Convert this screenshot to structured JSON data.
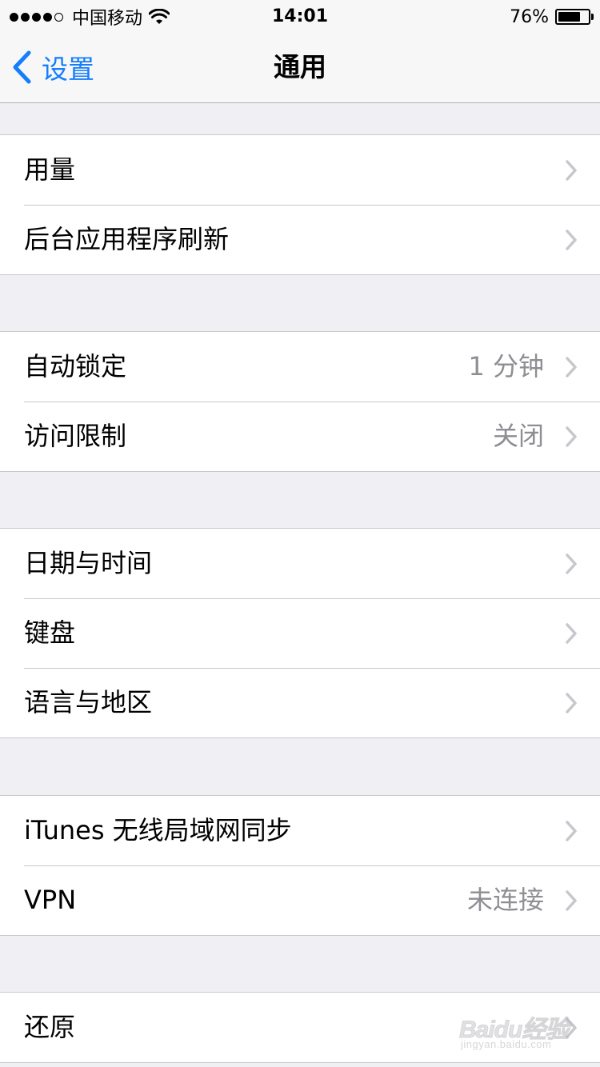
{
  "status_bar": {
    "signal_bars": 4,
    "signal_total": 5,
    "carrier": "中国移动",
    "time": "14:01",
    "battery_percent_label": "76%",
    "battery_level": 0.76,
    "icons": [
      "wifi-icon",
      "battery-icon"
    ]
  },
  "nav": {
    "back_label": "设置",
    "title": "通用",
    "accent_color": "#157efb"
  },
  "sections": [
    [
      {
        "label": "用量",
        "value": ""
      },
      {
        "label": "后台应用程序刷新",
        "value": ""
      }
    ],
    [
      {
        "label": "自动锁定",
        "value": "1 分钟"
      },
      {
        "label": "访问限制",
        "value": "关闭"
      }
    ],
    [
      {
        "label": "日期与时间",
        "value": ""
      },
      {
        "label": "键盘",
        "value": ""
      },
      {
        "label": "语言与地区",
        "value": ""
      }
    ],
    [
      {
        "label": "iTunes 无线局域网同步",
        "value": ""
      },
      {
        "label": "VPN",
        "value": "未连接"
      }
    ],
    [
      {
        "label": "还原",
        "value": ""
      }
    ]
  ],
  "watermark": {
    "logo_text": "Baidu经验",
    "url": "jingyan.baidu.com"
  }
}
